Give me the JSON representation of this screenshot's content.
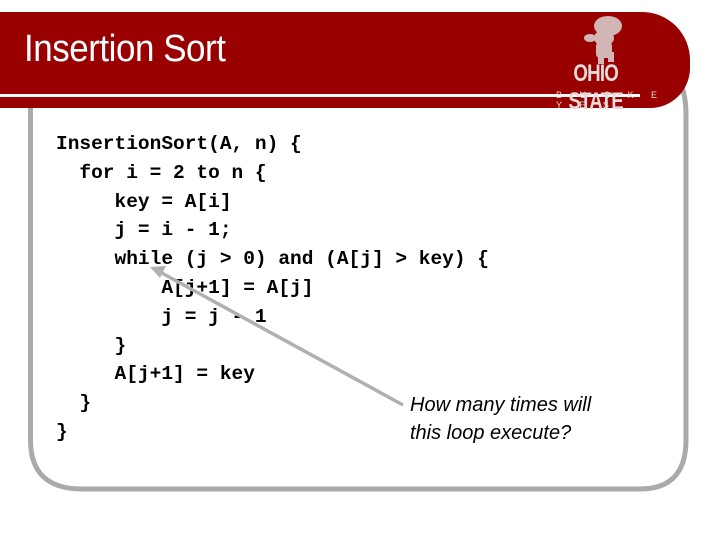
{
  "slide": {
    "title": "Insertion Sort",
    "logo": {
      "name": "Ohio State Buckeyes logo",
      "wordmark": "OHIO STATE",
      "subtitle": "B U C K E Y E S"
    },
    "code_lines": [
      "InsertionSort(A, n) {",
      "  for i = 2 to n {",
      "     key = A[i]",
      "     j = i - 1;",
      "     while (j > 0) and (A[j] > key) {",
      "         A[j+1] = A[j]",
      "         j = j - 1",
      "     }",
      "     A[j+1] = key",
      "  }",
      "}"
    ],
    "callout": {
      "lines": [
        "How many times will",
        "this loop execute?"
      ],
      "arrow_target": "while loop"
    },
    "colors": {
      "header_red": "#990000",
      "frame_gray": "#aaaaaa",
      "arrow_gray": "#b0b0b0",
      "text": "#000000"
    }
  }
}
